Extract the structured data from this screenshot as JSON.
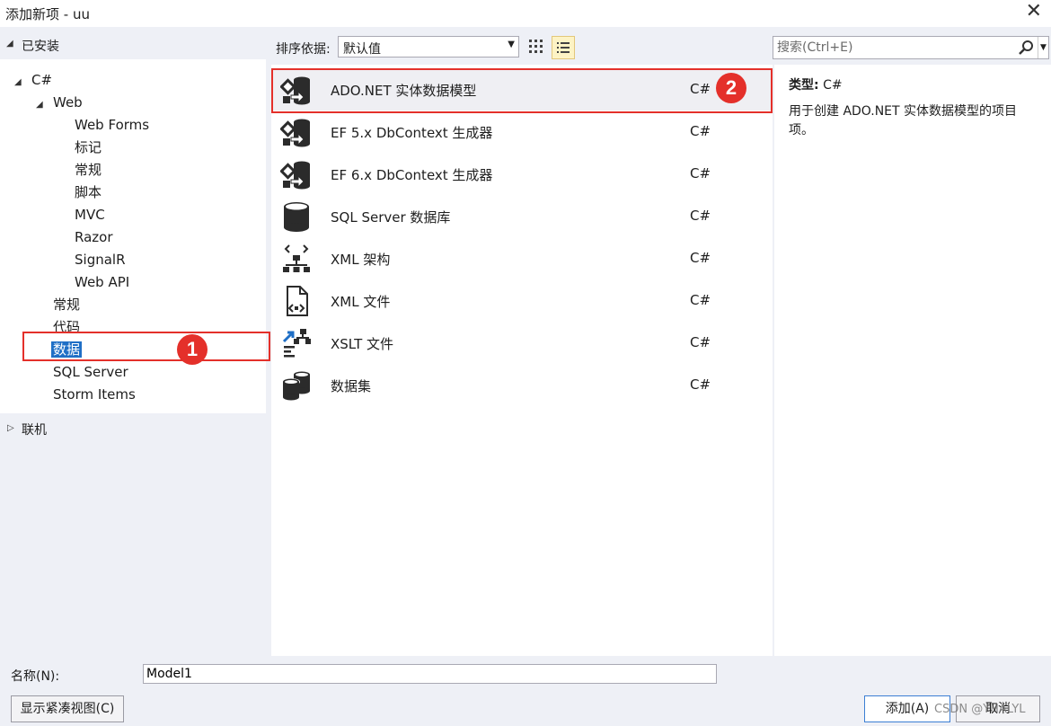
{
  "window": {
    "title": "添加新项 - uu"
  },
  "installed": {
    "label": "已安装"
  },
  "tree": {
    "root": "C#",
    "web": "Web",
    "web_children": [
      "Web Forms",
      "标记",
      "常规",
      "脚本",
      "MVC",
      "Razor",
      "SignalR",
      "Web API"
    ],
    "children": [
      "常规",
      "代码",
      "数据",
      "SQL Server",
      "Storm Items"
    ],
    "selected": "数据"
  },
  "online": {
    "label": "联机"
  },
  "sort": {
    "label": "排序依据:",
    "value": "默认值"
  },
  "search": {
    "placeholder": "搜索(Ctrl+E)"
  },
  "templates": [
    {
      "name": "ADO.NET 实体数据模型",
      "lang": "C#",
      "icon": "entity-model-icon"
    },
    {
      "name": "EF 5.x DbContext 生成器",
      "lang": "C#",
      "icon": "entity-model-icon"
    },
    {
      "name": "EF 6.x DbContext 生成器",
      "lang": "C#",
      "icon": "entity-model-icon"
    },
    {
      "name": "SQL Server 数据库",
      "lang": "C#",
      "icon": "database-icon"
    },
    {
      "name": "XML 架构",
      "lang": "C#",
      "icon": "xml-schema-icon"
    },
    {
      "name": "XML 文件",
      "lang": "C#",
      "icon": "xml-file-icon"
    },
    {
      "name": "XSLT 文件",
      "lang": "C#",
      "icon": "xslt-file-icon"
    },
    {
      "name": "数据集",
      "lang": "C#",
      "icon": "dataset-icon"
    }
  ],
  "description": {
    "type_label": "类型:",
    "type_value": "C#",
    "text": "用于创建 ADO.NET 实体数据模型的项目项。"
  },
  "annotations": {
    "badge1": "1",
    "badge2": "2"
  },
  "name_field": {
    "label": "名称(N):",
    "value": "Model1"
  },
  "buttons": {
    "compact": "显示紧凑视图(C)",
    "add": "添加(A)",
    "cancel": "取消"
  },
  "watermark": "CSDN @YHALYL",
  "colors": {
    "selection": "#1f6fc6",
    "annotation_red": "#e4302a",
    "list_view_active": "#fdf3c5"
  }
}
